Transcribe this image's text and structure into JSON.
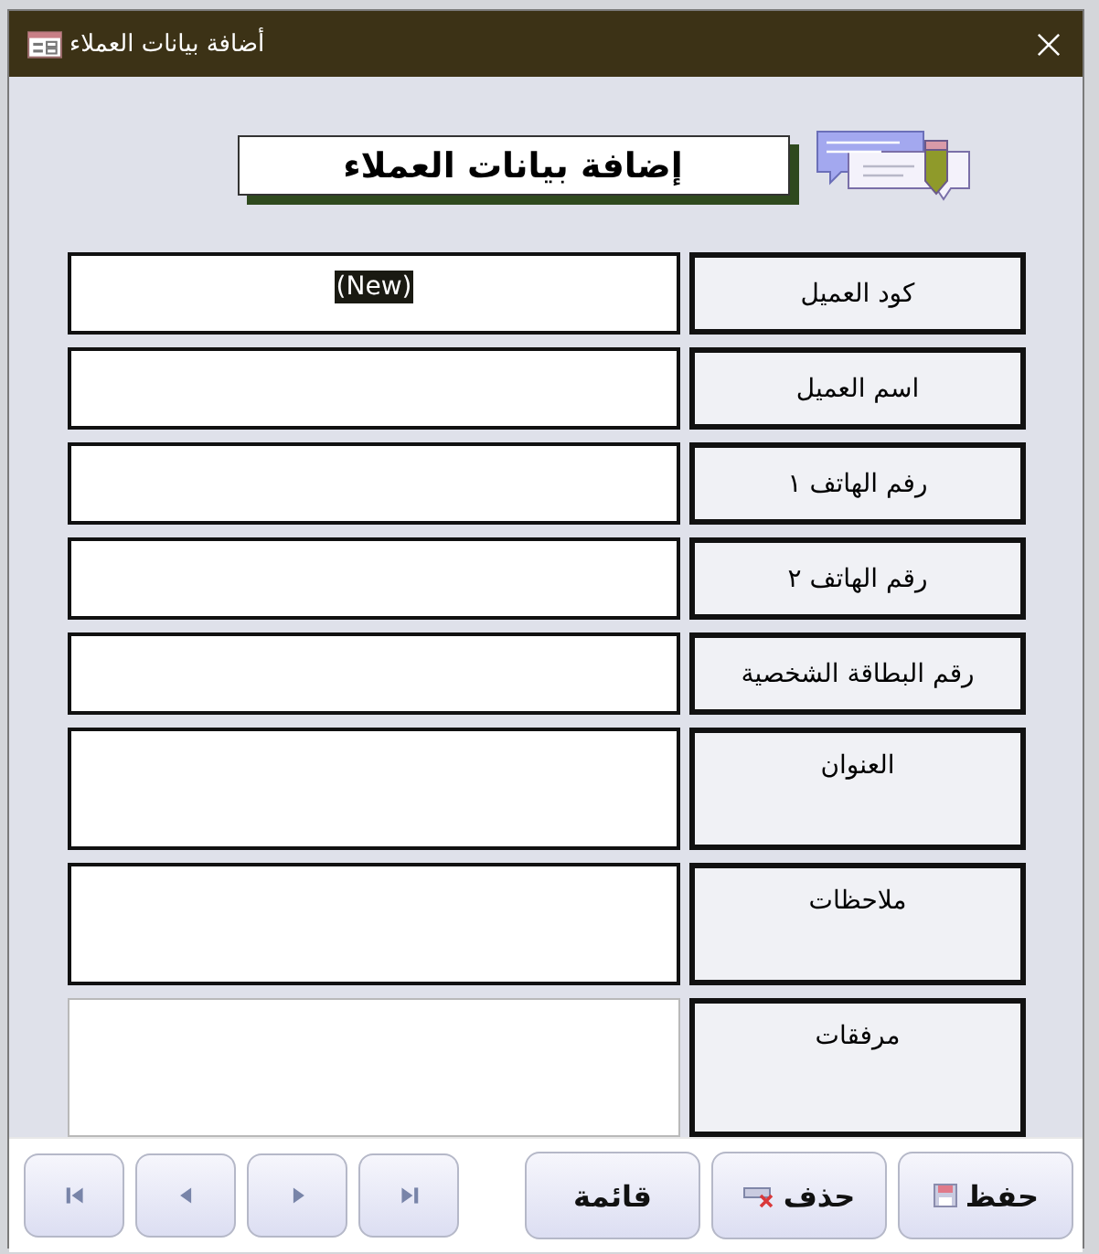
{
  "window": {
    "title": "أضافة بيانات العملاء"
  },
  "header": {
    "title": "إضافة بيانات العملاء"
  },
  "fields": [
    {
      "label": "كود العميل",
      "kind": "text",
      "value": "(New)",
      "highlighted": true
    },
    {
      "label": "اسم العميل",
      "kind": "text"
    },
    {
      "label": "رفم الهاتف ١",
      "kind": "text"
    },
    {
      "label": "رقم الهاتف ٢",
      "kind": "text"
    },
    {
      "label": "رقم البطاقة الشخصية",
      "kind": "text"
    },
    {
      "label": "العنوان",
      "kind": "memo"
    },
    {
      "label": "ملاحظات",
      "kind": "memo"
    },
    {
      "label": "مرفقات",
      "kind": "attachment"
    }
  ],
  "buttons": [
    {
      "label": "حفظ",
      "kind": "save"
    },
    {
      "label": "حذف",
      "kind": "delete"
    },
    {
      "label": "قائمة",
      "kind": "list"
    }
  ],
  "navigation": [
    {
      "kind": "first"
    },
    {
      "kind": "previous"
    },
    {
      "kind": "next"
    },
    {
      "kind": "last"
    }
  ]
}
